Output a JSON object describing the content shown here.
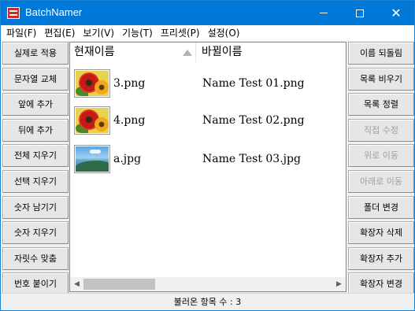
{
  "window": {
    "title": "BatchNamer"
  },
  "menu": [
    {
      "label": "파일(F)"
    },
    {
      "label": "편집(E)"
    },
    {
      "label": "보기(V)"
    },
    {
      "label": "기능(T)"
    },
    {
      "label": "프리셋(P)"
    },
    {
      "label": "설정(O)"
    }
  ],
  "left_buttons": [
    {
      "label": "실제로 적용"
    },
    {
      "label": "문자열 교체"
    },
    {
      "label": "앞에 추가"
    },
    {
      "label": "뒤에 추가"
    },
    {
      "label": "전체 지우기"
    },
    {
      "label": "선택 지우기"
    },
    {
      "label": "숫자 남기기"
    },
    {
      "label": "숫자 지우기"
    },
    {
      "label": "자릿수 맞춤"
    },
    {
      "label": "번호 붙이기"
    }
  ],
  "right_buttons": [
    {
      "label": "이름 되돌림",
      "enabled": true
    },
    {
      "label": "목록 비우기",
      "enabled": true
    },
    {
      "label": "목록 정렬",
      "enabled": true
    },
    {
      "label": "직접 수정",
      "enabled": false
    },
    {
      "label": "위로 이동",
      "enabled": false
    },
    {
      "label": "아래로 이동",
      "enabled": false
    },
    {
      "label": "폴더 변경",
      "enabled": true
    },
    {
      "label": "확장자 삭제",
      "enabled": true
    },
    {
      "label": "확장자 추가",
      "enabled": true
    },
    {
      "label": "확장자 변경",
      "enabled": true
    }
  ],
  "list": {
    "columns": {
      "current": "현재이름",
      "changed": "바뀔이름"
    },
    "sort_icon": "sort-ascending-icon",
    "rows": [
      {
        "current": "3.png",
        "changed": "Name Test 01.png",
        "thumbnail_icon": "flower-thumbnail-icon"
      },
      {
        "current": "4.png",
        "changed": "Name Test 02.png",
        "thumbnail_icon": "flower-thumbnail-icon"
      },
      {
        "current": "a.jpg",
        "changed": "Name Test 03.jpg",
        "thumbnail_icon": "landscape-thumbnail-icon"
      }
    ]
  },
  "status": {
    "text": "불러온 항목 수 : 3"
  },
  "colors": {
    "titlebar": "#0078d7",
    "disabled_text": "#a0a0a0"
  }
}
